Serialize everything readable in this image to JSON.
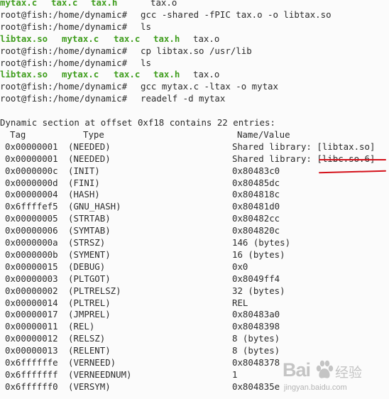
{
  "terminal": {
    "lines": [
      {
        "type": "files",
        "items": [
          "mytax.c",
          "tax.c",
          "tax.h",
          "tax.o"
        ]
      },
      {
        "type": "cmd",
        "prompt": "root@fish:/home/dynamic#",
        "command": "gcc -shared -fPIC tax.o -o libtax.so"
      },
      {
        "type": "cmd",
        "prompt": "root@fish:/home/dynamic#",
        "command": "ls"
      },
      {
        "type": "files",
        "items": [
          "libtax.so",
          "mytax.c",
          "tax.c",
          "tax.h",
          "tax.o"
        ]
      },
      {
        "type": "cmd",
        "prompt": "root@fish:/home/dynamic#",
        "command": "cp libtax.so /usr/lib"
      },
      {
        "type": "cmd",
        "prompt": "root@fish:/home/dynamic#",
        "command": "ls"
      },
      {
        "type": "files",
        "items": [
          "libtax.so",
          "mytax.c",
          "tax.c",
          "tax.h",
          "tax.o"
        ]
      },
      {
        "type": "cmd",
        "prompt": "root@fish:/home/dynamic#",
        "command": "gcc mytax.c -ltax -o mytax"
      },
      {
        "type": "cmd",
        "prompt": "root@fish:/home/dynamic#",
        "command": "readelf -d mytax"
      },
      {
        "type": "blank"
      },
      {
        "type": "text",
        "text": "Dynamic section at offset 0xf18 contains 22 entries:"
      },
      {
        "type": "row",
        "tag": "Tag",
        "ttype": "Type",
        "value": "Name/Value"
      },
      {
        "type": "row",
        "tag": "0x00000001",
        "ttype": "(NEEDED)",
        "value": "Shared library: [libtax.so]"
      },
      {
        "type": "row",
        "tag": "0x00000001",
        "ttype": "(NEEDED)",
        "value": "Shared library: [libc.so.6]"
      },
      {
        "type": "row",
        "tag": "0x0000000c",
        "ttype": "(INIT)",
        "value": "0x80483c0"
      },
      {
        "type": "row",
        "tag": "0x0000000d",
        "ttype": "(FINI)",
        "value": "0x80485dc"
      },
      {
        "type": "row",
        "tag": "0x00000004",
        "ttype": "(HASH)",
        "value": "0x804818c"
      },
      {
        "type": "row",
        "tag": "0x6ffffef5",
        "ttype": "(GNU_HASH)",
        "value": "0x80481d0"
      },
      {
        "type": "row",
        "tag": "0x00000005",
        "ttype": "(STRTAB)",
        "value": "0x80482cc"
      },
      {
        "type": "row",
        "tag": "0x00000006",
        "ttype": "(SYMTAB)",
        "value": "0x804820c"
      },
      {
        "type": "row",
        "tag": "0x0000000a",
        "ttype": "(STRSZ)",
        "value": "146 (bytes)"
      },
      {
        "type": "row",
        "tag": "0x0000000b",
        "ttype": "(SYMENT)",
        "value": "16 (bytes)"
      },
      {
        "type": "row",
        "tag": "0x00000015",
        "ttype": "(DEBUG)",
        "value": "0x0"
      },
      {
        "type": "row",
        "tag": "0x00000003",
        "ttype": "(PLTGOT)",
        "value": "0x8049ff4"
      },
      {
        "type": "row",
        "tag": "0x00000002",
        "ttype": "(PLTRELSZ)",
        "value": "32 (bytes)"
      },
      {
        "type": "row",
        "tag": "0x00000014",
        "ttype": "(PLTREL)",
        "value": "REL"
      },
      {
        "type": "row",
        "tag": "0x00000017",
        "ttype": "(JMPREL)",
        "value": "0x80483a0"
      },
      {
        "type": "row",
        "tag": "0x00000011",
        "ttype": "(REL)",
        "value": "0x8048398"
      },
      {
        "type": "row",
        "tag": "0x00000012",
        "ttype": "(RELSZ)",
        "value": "8 (bytes)"
      },
      {
        "type": "row",
        "tag": "0x00000013",
        "ttype": "(RELENT)",
        "value": "8 (bytes)"
      },
      {
        "type": "row",
        "tag": "0x6ffffffe",
        "ttype": "(VERNEED)",
        "value": "0x8048378"
      },
      {
        "type": "row",
        "tag": "0x6fffffff",
        "ttype": "(VERNEEDNUM)",
        "value": "1"
      },
      {
        "type": "row",
        "tag": "0x6ffffff0",
        "ttype": "(VERSYM)",
        "value": "0x804835e"
      }
    ]
  },
  "annotation": {
    "color": "#d4111a"
  },
  "colors": {
    "file_highlight": "#3f9d1d",
    "text": "#2b2b2b",
    "background": "#fbfbfb"
  },
  "watermark": {
    "logo": "Bai 经验",
    "url": "jingyan.baidu.com",
    "icon": "paw-icon"
  }
}
